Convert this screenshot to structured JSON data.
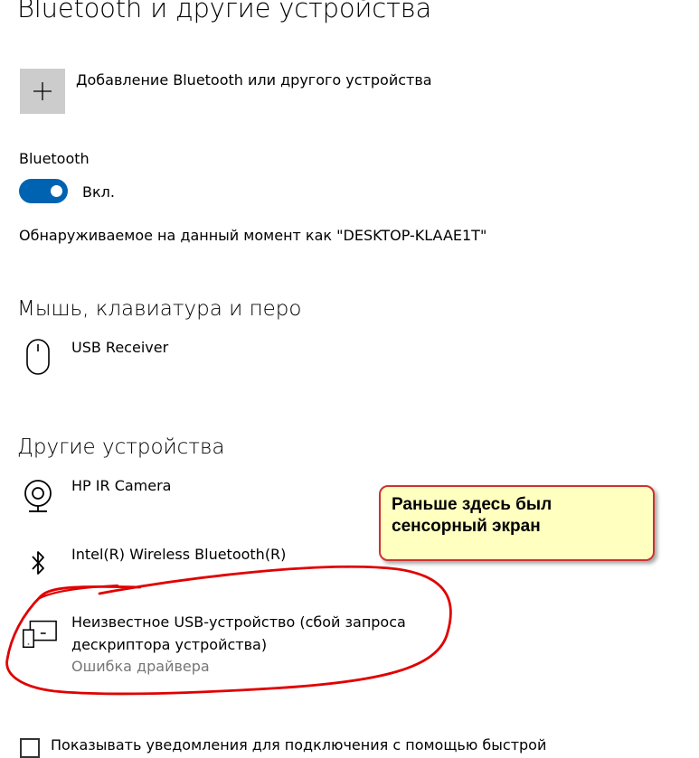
{
  "page": {
    "title": "Bluetooth и другие устройства"
  },
  "add_device": {
    "label": "Добавление Bluetooth или другого устройства",
    "icon": "plus-icon"
  },
  "bluetooth": {
    "heading": "Bluetooth",
    "toggle_state": "on",
    "toggle_label": "Вкл.",
    "accent_color": "#0063b1",
    "discoverable_text": "Обнаруживаемое на данный момент как \"DESKTOP-KLAAE1T\""
  },
  "mouse_section": {
    "title": "Мышь, клавиатура и перо",
    "devices": [
      {
        "name": "USB Receiver",
        "icon": "mouse-icon"
      }
    ]
  },
  "other_section": {
    "title": "Другие устройства",
    "devices": [
      {
        "name": "HP IR Camera",
        "icon": "webcam-icon"
      },
      {
        "name": "Intel(R) Wireless Bluetooth(R)",
        "icon": "bluetooth-icon"
      },
      {
        "name_line1": "Неизвестное USB-устройство (сбой запроса",
        "name_line2": "дескриптора устройства)",
        "status": "Ошибка драйвера",
        "icon": "unknown-device-icon"
      }
    ]
  },
  "annotation": {
    "line1": "Раньше здесь был",
    "line2": "сенсорный экран",
    "callout_background": "#ffffc0",
    "border_color": "#cc3333",
    "circle_color": "#e00000"
  },
  "notifications": {
    "checkbox_label": "Показывать уведомления для подключения с помощью быстрой"
  }
}
